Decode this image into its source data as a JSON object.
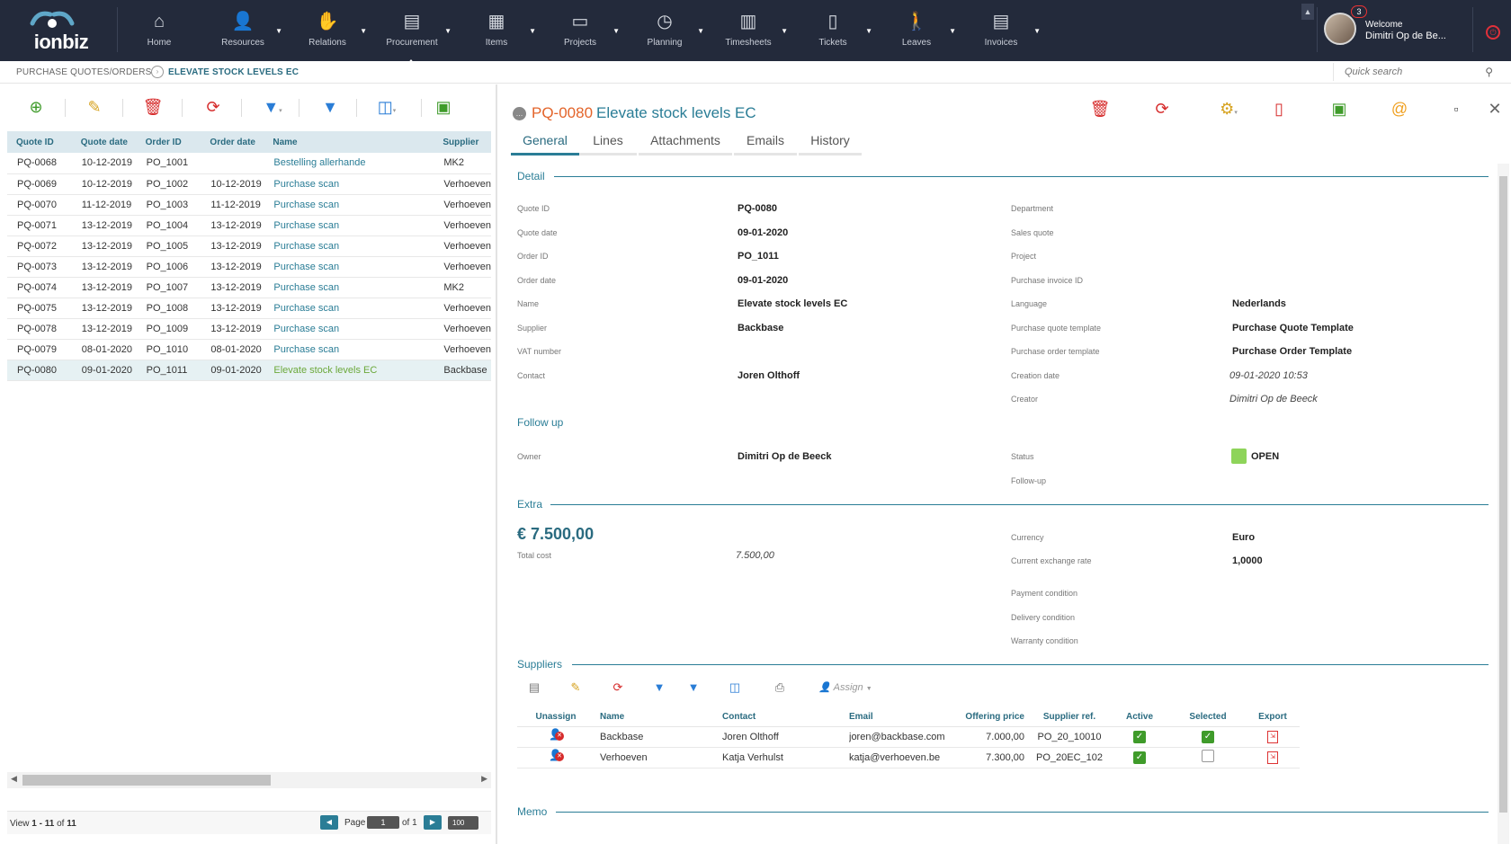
{
  "app": {
    "name": "ionbiz",
    "brand_color": "#232a3b",
    "accent": "#2a7d96"
  },
  "nav": [
    {
      "label": "Home",
      "icon": "home-icon",
      "caret": false
    },
    {
      "label": "Resources",
      "icon": "resources-icon",
      "caret": true
    },
    {
      "label": "Relations",
      "icon": "relations-icon",
      "caret": true
    },
    {
      "label": "Procurement",
      "icon": "procurement-icon",
      "caret": true
    },
    {
      "label": "Items",
      "icon": "items-icon",
      "caret": true
    },
    {
      "label": "Projects",
      "icon": "projects-icon",
      "caret": true
    },
    {
      "label": "Planning",
      "icon": "planning-icon",
      "caret": true
    },
    {
      "label": "Timesheets",
      "icon": "timesheets-icon",
      "caret": true
    },
    {
      "label": "Tickets",
      "icon": "tickets-icon",
      "caret": true
    },
    {
      "label": "Leaves",
      "icon": "leaves-icon",
      "caret": true
    },
    {
      "label": "Invoices",
      "icon": "invoices-icon",
      "caret": true
    }
  ],
  "user": {
    "welcome": "Welcome",
    "name": "Dimitri Op de Be...",
    "notifications": "3"
  },
  "breadcrumb": {
    "section": "PURCHASE QUOTES/ORDERS",
    "current": "ELEVATE STOCK LEVELS EC"
  },
  "search": {
    "placeholder": "Quick search"
  },
  "grid": {
    "columns": [
      "Quote ID",
      "Quote date",
      "Order ID",
      "Order date",
      "Name",
      "Supplier"
    ],
    "rows": [
      [
        "PQ-0068",
        "10-12-2019",
        "PO_1001",
        "",
        "Bestelling allerhande",
        "MK2"
      ],
      [
        "PQ-0069",
        "10-12-2019",
        "PO_1002",
        "10-12-2019",
        "Purchase scan",
        "Verhoeven"
      ],
      [
        "PQ-0070",
        "11-12-2019",
        "PO_1003",
        "11-12-2019",
        "Purchase scan",
        "Verhoeven"
      ],
      [
        "PQ-0071",
        "13-12-2019",
        "PO_1004",
        "13-12-2019",
        "Purchase scan",
        "Verhoeven"
      ],
      [
        "PQ-0072",
        "13-12-2019",
        "PO_1005",
        "13-12-2019",
        "Purchase scan",
        "Verhoeven"
      ],
      [
        "PQ-0073",
        "13-12-2019",
        "PO_1006",
        "13-12-2019",
        "Purchase scan",
        "Verhoeven"
      ],
      [
        "PQ-0074",
        "13-12-2019",
        "PO_1007",
        "13-12-2019",
        "Purchase scan",
        "MK2"
      ],
      [
        "PQ-0075",
        "13-12-2019",
        "PO_1008",
        "13-12-2019",
        "Purchase scan",
        "Verhoeven"
      ],
      [
        "PQ-0078",
        "13-12-2019",
        "PO_1009",
        "13-12-2019",
        "Purchase scan",
        "Verhoeven"
      ],
      [
        "PQ-0079",
        "08-01-2020",
        "PO_1010",
        "08-01-2020",
        "Purchase scan",
        "Verhoeven"
      ],
      [
        "PQ-0080",
        "09-01-2020",
        "PO_1011",
        "09-01-2020",
        "Elevate stock levels EC",
        "Backbase"
      ]
    ],
    "selected_row": 10
  },
  "pager": {
    "view_prefix": "View ",
    "view_range": "1 - 11",
    "view_of": " of ",
    "view_total": "11",
    "page_label": "Page",
    "page_value": "1",
    "of_label": "of 1",
    "rows_per_page": "100"
  },
  "detail": {
    "id": "PQ-0080",
    "title": "Elevate stock levels EC",
    "tabs": [
      "General",
      "Lines",
      "Attachments",
      "Emails",
      "History"
    ],
    "sections": {
      "detail": "Detail",
      "followup": "Follow up",
      "extra": "Extra",
      "suppliers": "Suppliers",
      "memo": "Memo"
    },
    "left_fields": [
      {
        "label": "Quote ID",
        "value": "PQ-0080"
      },
      {
        "label": "Quote date",
        "value": "09-01-2020"
      },
      {
        "label": "Order ID",
        "value": "PO_1011"
      },
      {
        "label": "Order date",
        "value": "09-01-2020"
      },
      {
        "label": "Name",
        "value": "Elevate stock levels EC"
      },
      {
        "label": "Supplier",
        "value": "Backbase"
      },
      {
        "label": "VAT number",
        "value": ""
      },
      {
        "label": "Contact",
        "value": "Joren  Olthoff"
      }
    ],
    "right_fields": [
      {
        "label": "Department",
        "value": ""
      },
      {
        "label": "Sales quote",
        "value": ""
      },
      {
        "label": "Project",
        "value": ""
      },
      {
        "label": "Purchase invoice ID",
        "value": ""
      },
      {
        "label": "Language",
        "value": "Nederlands"
      },
      {
        "label": "Purchase quote template",
        "value": "Purchase Quote Template"
      },
      {
        "label": "Purchase order template",
        "value": "Purchase Order Template"
      },
      {
        "label": "Creation date",
        "value": "09-01-2020 10:53"
      },
      {
        "label": "Creator",
        "value": "Dimitri Op de Beeck"
      }
    ],
    "followup": {
      "owner_label": "Owner",
      "owner": "Dimitri Op de Beeck",
      "status_label": "Status",
      "status": "OPEN",
      "status_color": "#8ed45a",
      "followup_label": "Follow-up"
    },
    "extra": {
      "total_amount": "€ 7.500,00",
      "total_label": "Total cost",
      "total_value": "7.500,00",
      "currency_label": "Currency",
      "currency": "Euro",
      "rate_label": "Current exchange rate",
      "rate": "1,0000",
      "payment_label": "Payment condition",
      "delivery_label": "Delivery condition",
      "warranty_label": "Warranty condition"
    },
    "suppliers": {
      "assign_label": "Assign",
      "columns": [
        "Unassign",
        "Name",
        "Contact",
        "Email",
        "Offering price",
        "Supplier ref.",
        "Active",
        "Selected",
        "Export"
      ],
      "rows": [
        {
          "name": "Backbase",
          "contact": "Joren Olthoff",
          "email": "joren@backbase.com",
          "price": "7.000,00",
          "ref": "PO_20_10010",
          "active": true,
          "selected": true
        },
        {
          "name": "Verhoeven",
          "contact": "Katja Verhulst",
          "email": "katja@verhoeven.be",
          "price": "7.300,00",
          "ref": "PO_20EC_102",
          "active": true,
          "selected": false
        }
      ]
    }
  }
}
